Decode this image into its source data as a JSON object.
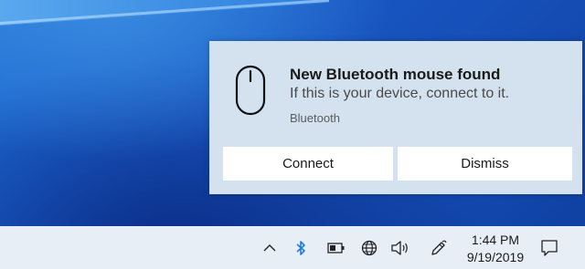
{
  "notification": {
    "title": "New Bluetooth mouse found",
    "message": "If this is your device, connect to it.",
    "source": "Bluetooth",
    "icon": "mouse-icon",
    "buttons": {
      "connect": "Connect",
      "dismiss": "Dismiss"
    }
  },
  "taskbar": {
    "tray_icons": [
      "chevron-up-icon",
      "bluetooth-icon",
      "battery-icon",
      "network-globe-icon",
      "volume-icon",
      "pen-icon"
    ],
    "time": "1:44 PM",
    "date": "9/19/2019",
    "action_center_icon": "notification-center-icon"
  },
  "colors": {
    "toast_background": "#d4e2ef",
    "taskbar_background": "#e8eef6",
    "bluetooth_accent": "#1e7be0",
    "desktop_blue": "#1855c0"
  }
}
